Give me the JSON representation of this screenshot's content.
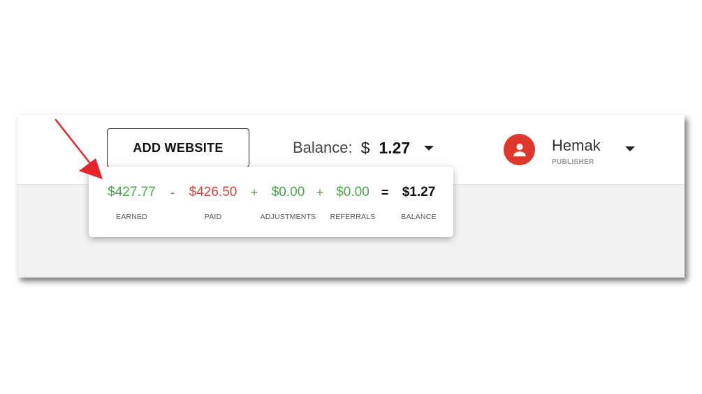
{
  "header": {
    "add_website_label": "ADD WEBSITE",
    "balance_label": "Balance:",
    "balance_currency": "$",
    "balance_amount": "1.27"
  },
  "user": {
    "name": "Hemak",
    "role": "PUBLISHER"
  },
  "breakdown": {
    "earned": {
      "value": "$427.77",
      "caption": "EARNED"
    },
    "op1": "-",
    "paid": {
      "value": "$426.50",
      "caption": "PAID"
    },
    "op2": "+",
    "adjustments": {
      "value": "$0.00",
      "caption": "ADJUSTMENTS"
    },
    "op3": "+",
    "referrals": {
      "value": "$0.00",
      "caption": "REFERRALS"
    },
    "op4": "=",
    "balance": {
      "value": "$1.27",
      "caption": "BALANCE"
    }
  },
  "colors": {
    "positive": "#46a846",
    "negative": "#d8413a",
    "avatar": "#e0372b",
    "annotation_arrow": "#e5232a"
  },
  "icons": {
    "avatar": "person-icon",
    "dropdown": "caret-down-icon",
    "annotation": "red-arrow-annotation"
  }
}
